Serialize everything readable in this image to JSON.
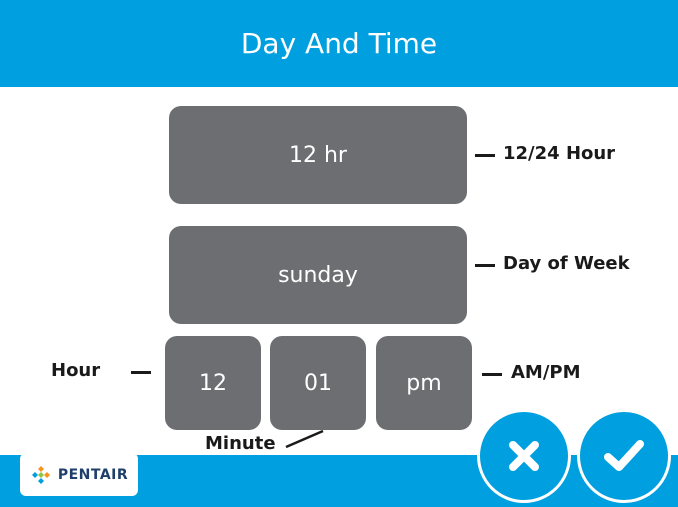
{
  "header": {
    "title": "Day And Time"
  },
  "settings": {
    "hour_format": "12 hr",
    "day_of_week": "sunday",
    "hour": "12",
    "minute": "01",
    "ampm": "pm"
  },
  "annotations": {
    "hour_format": "12/24 Hour",
    "day_of_week": "Day of Week",
    "hour": "Hour",
    "ampm": "AM/PM",
    "minute": "Minute"
  },
  "footer": {
    "brand": "PENTAIR",
    "cancel_icon": "close-icon",
    "confirm_icon": "checkmark-icon"
  },
  "colors": {
    "accent": "#009fdf",
    "button": "#6d6e71",
    "brand_text": "#1f3f6b"
  }
}
